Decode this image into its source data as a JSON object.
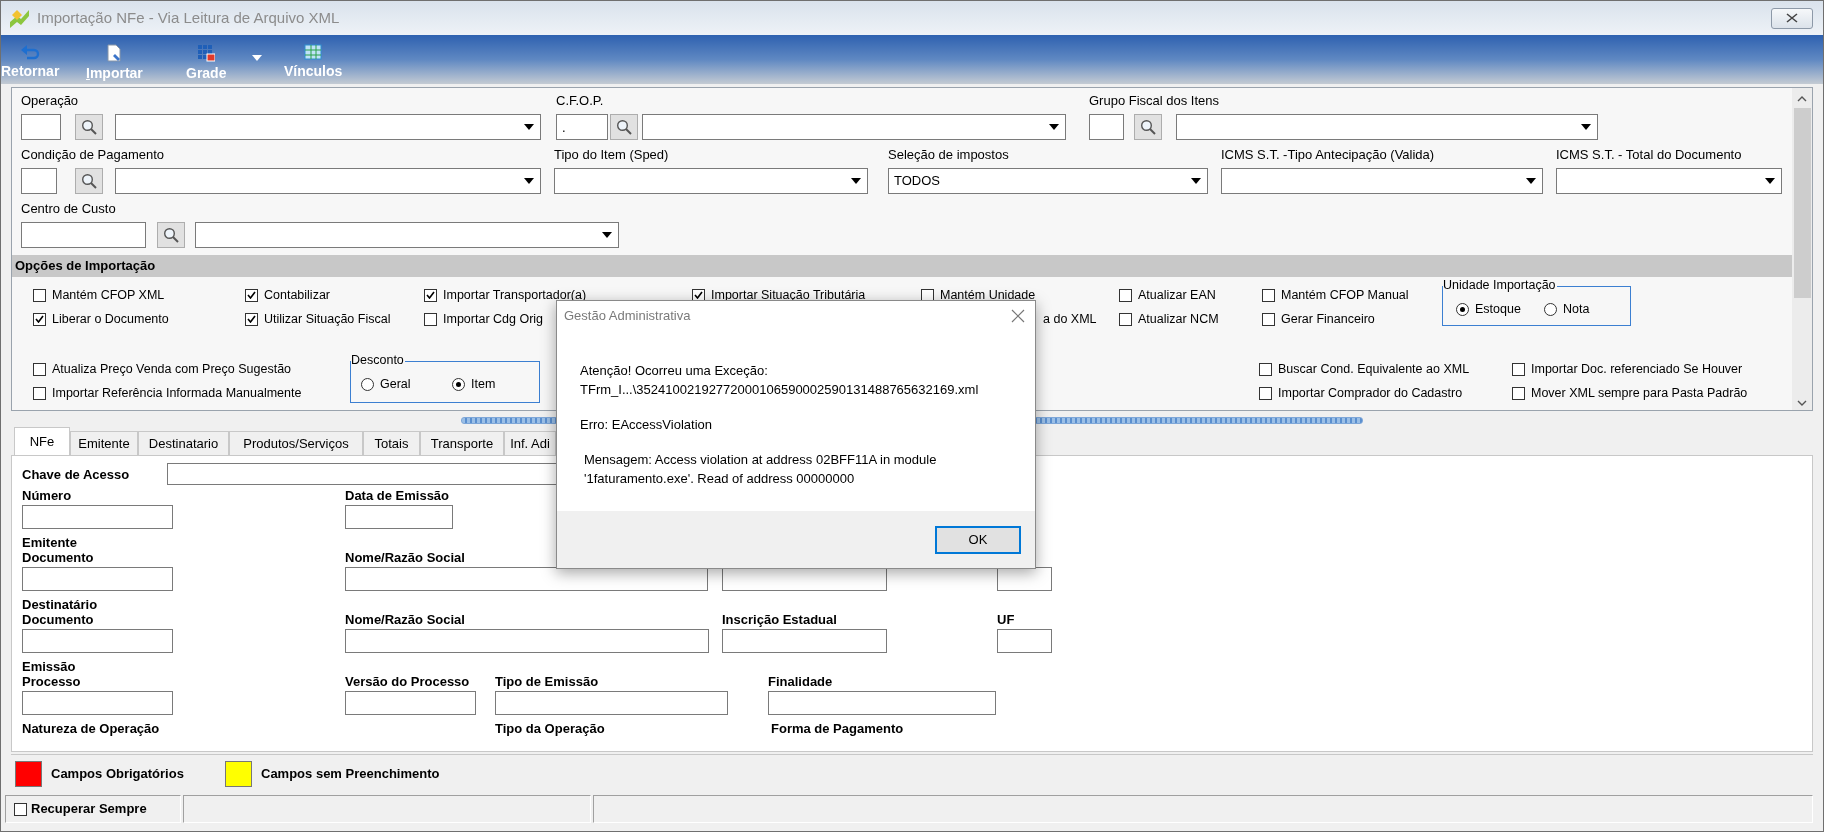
{
  "window": {
    "title": "Importação NFe - Via Leitura de Arquivo XML"
  },
  "toolbar": [
    {
      "label": "Retornar",
      "mnemonic": false,
      "dropdown": false
    },
    {
      "label": "Importar",
      "mnemonic": true,
      "dropdown": false
    },
    {
      "label": "Grade",
      "mnemonic": false,
      "dropdown": true
    },
    {
      "label": "Vínculos",
      "mnemonic": false,
      "dropdown": false
    }
  ],
  "filters": [
    [
      {
        "label": "Operação",
        "lookup": true
      },
      {
        "label": "C.F.O.P.",
        "lookup": true,
        "code": "."
      },
      {
        "label": "Grupo Fiscal dos Itens",
        "lookup": true
      }
    ],
    [
      {
        "label": "Condição de Pagamento",
        "lookup": true
      },
      {
        "label": "Tipo do Item (Sped)",
        "lookup": false
      },
      {
        "label": "Seleção de impostos",
        "lookup": false,
        "value": "TODOS"
      },
      {
        "label": "ICMS S.T. -Tipo Antecipação (Valida)",
        "lookup": false
      },
      {
        "label": "ICMS S.T. - Total do Documento",
        "lookup": false
      }
    ],
    [
      {
        "label": "Centro de Custo",
        "lookup": true
      }
    ]
  ],
  "options": {
    "title": "Opções de Importação",
    "blocks": [
      [
        {
          "kind": "column",
          "items": [
            {
              "kind": "checkbox",
              "label": "Mantém CFOP XML",
              "checked": false
            },
            {
              "kind": "checkbox",
              "label": "Liberar o Documento",
              "checked": true
            }
          ]
        },
        {
          "kind": "column",
          "items": [
            {
              "kind": "checkbox",
              "label": "Contabilizar",
              "checked": true
            },
            {
              "kind": "checkbox",
              "label": "Utilizar Situação Fiscal",
              "checked": true
            }
          ]
        },
        {
          "kind": "column",
          "items": [
            {
              "kind": "checkbox",
              "label": "Importar Transportador(a)",
              "checked": true
            },
            {
              "kind": "checkbox",
              "label": "Importar Cdg Orig",
              "checked": false
            }
          ]
        },
        {
          "kind": "column",
          "items": [
            {
              "kind": "checkbox",
              "label": "Importar Situação Tributária",
              "checked": true
            }
          ]
        },
        {
          "kind": "column",
          "items": [
            {
              "kind": "checkbox",
              "label": "Mantém Unidade",
              "checked": false
            },
            {
              "kind": "text",
              "label": "a do XML"
            }
          ]
        },
        {
          "kind": "column",
          "items": [
            {
              "kind": "checkbox",
              "label": "Atualizar EAN",
              "checked": false
            },
            {
              "kind": "checkbox",
              "label": "Atualizar NCM",
              "checked": false
            }
          ]
        },
        {
          "kind": "column",
          "items": [
            {
              "kind": "checkbox",
              "label": "Mantém CFOP Manual",
              "checked": false
            },
            {
              "kind": "checkbox",
              "label": "Gerar Financeiro",
              "checked": false
            }
          ]
        },
        {
          "kind": "radio_group",
          "title": "Unidade Importação",
          "options": [
            {
              "label": "Estoque",
              "selected": true
            },
            {
              "label": "Nota",
              "selected": false
            }
          ]
        }
      ],
      [
        {
          "kind": "column",
          "items": [
            {
              "kind": "checkbox",
              "label": "Atualiza Preço Venda com Preço Sugestão",
              "checked": false
            },
            {
              "kind": "checkbox",
              "label": "Importar Referência Informada Manualmente",
              "checked": false
            }
          ]
        },
        {
          "kind": "radio_group",
          "title": "Desconto",
          "options": [
            {
              "label": "Geral",
              "selected": false
            },
            {
              "label": "Item",
              "selected": true
            }
          ]
        },
        {
          "kind": "column",
          "items": [
            {
              "kind": "checkbox",
              "label": "Buscar Cond. Equivalente ao XML",
              "checked": false
            },
            {
              "kind": "checkbox",
              "label": "Importar Comprador do Cadastro",
              "checked": false
            }
          ]
        },
        {
          "kind": "column",
          "items": [
            {
              "kind": "checkbox",
              "label": "Importar Doc. referenciado Se Houver",
              "checked": false
            },
            {
              "kind": "checkbox",
              "label": "Mover XML sempre para Pasta Padrão",
              "checked": false
            }
          ]
        }
      ]
    ]
  },
  "tabs": [
    {
      "label": "NFe",
      "selected": true
    },
    {
      "label": "Emitente",
      "selected": false
    },
    {
      "label": "Destinatario",
      "selected": false
    },
    {
      "label": "Produtos/Serviços",
      "selected": false
    },
    {
      "label": "Totais",
      "selected": false
    },
    {
      "label": "Transporte",
      "selected": false
    },
    {
      "label": "Inf. Adi",
      "selected": false
    }
  ],
  "form": {
    "access_key": {
      "label": "Chave de Acesso"
    },
    "rows": [
      {
        "fields": [
          {
            "kind": "input",
            "label": "Número"
          },
          {
            "kind": "input",
            "label": "Data de Emissão"
          }
        ]
      },
      {
        "heading": "Emitente",
        "fields": [
          {
            "kind": "input",
            "label": "Documento"
          },
          {
            "kind": "input",
            "label": "Nome/Razão Social"
          },
          {
            "kind": "input"
          },
          {
            "kind": "input"
          }
        ]
      },
      {
        "heading": "Destinatário",
        "fields": [
          {
            "kind": "input",
            "label": "Documento"
          },
          {
            "kind": "input",
            "label": "Nome/Razão Social"
          },
          {
            "kind": "input",
            "label": "Inscrição Estadual"
          },
          {
            "kind": "input",
            "label": "UF"
          }
        ]
      },
      {
        "heading": "Emissão",
        "fields": [
          {
            "kind": "input",
            "label": "Processo"
          },
          {
            "kind": "input",
            "label": "Versão do Processo"
          },
          {
            "kind": "input",
            "label": "Tipo de Emissão"
          },
          {
            "kind": "input",
            "label": "Finalidade"
          }
        ]
      },
      {
        "fields": [
          {
            "kind": "label",
            "label": "Natureza de Operação"
          },
          {
            "kind": "label",
            "label": "Tipo da Operação"
          },
          {
            "kind": "label",
            "label": "Forma de Pagamento"
          }
        ]
      }
    ]
  },
  "legend": [
    {
      "label": "Campos Obrigatórios",
      "color": "#ff0000"
    },
    {
      "label": "Campos sem Preenchimento",
      "color": "#ffff00"
    }
  ],
  "status_bar": {
    "checkbox": {
      "label": "Recuperar Sempre",
      "checked": false
    }
  },
  "dialog": {
    "title": "Gestão Administrativa",
    "paragraphs": [
      [
        "Atenção! Ocorreu uma Exceção:",
        "TFrm_I...\\35241002192772000106590002590131488765632169.xml"
      ],
      [
        "Erro: EAccessViolation"
      ],
      [
        "Mensagem: Access violation at address 02BFF11A in module",
        "'1faturamento.exe'. Read of address 00000000"
      ]
    ],
    "button": "OK"
  }
}
